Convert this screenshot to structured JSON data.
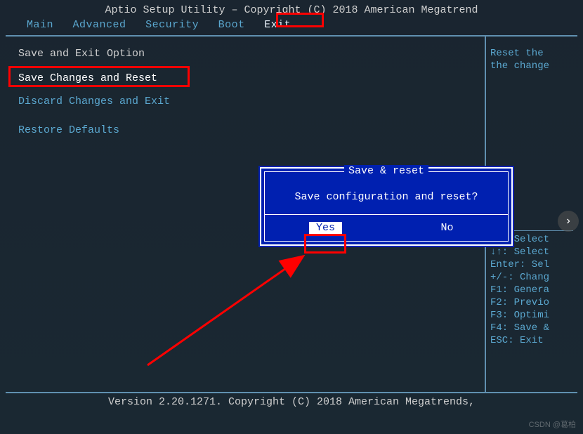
{
  "title": "Aptio Setup Utility – Copyright (C) 2018 American Megatrend",
  "menu": {
    "items": [
      "Main",
      "Advanced",
      "Security",
      "Boot",
      "Exit"
    ],
    "active_index": 4
  },
  "left": {
    "section": "Save and Exit Option",
    "options": [
      "Save Changes and Reset",
      "Discard Changes and Exit",
      "Restore Defaults"
    ],
    "selected_index": 0
  },
  "right": {
    "help_top": [
      "Reset the",
      "the change"
    ],
    "help_keys": [
      "→←: Select",
      "↓↑: Select",
      "Enter: Sel",
      "+/-: Chang",
      "F1: Genera",
      "F2: Previo",
      "F3: Optimi",
      "F4: Save &",
      "ESC: Exit"
    ]
  },
  "dialog": {
    "title": "Save & reset",
    "message": "Save configuration and reset?",
    "buttons": [
      "Yes",
      "No"
    ],
    "active_index": 0
  },
  "footer": "Version 2.20.1271. Copyright (C) 2018 American Megatrends,",
  "watermark": "CSDN @葛柏"
}
